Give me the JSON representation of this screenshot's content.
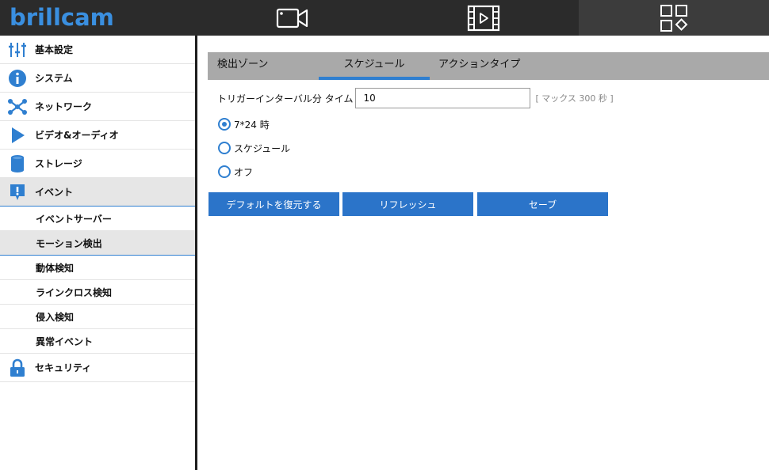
{
  "brand": {
    "name": "brillcam"
  },
  "topnav": [
    {
      "icon": "video-camera-icon"
    },
    {
      "icon": "film-playback-icon"
    },
    {
      "icon": "settings-grid-icon"
    }
  ],
  "sidebar": {
    "items": [
      {
        "label": "基本設定",
        "icon": "sliders-icon"
      },
      {
        "label": "システム",
        "icon": "info-icon"
      },
      {
        "label": "ネットワーク",
        "icon": "network-icon"
      },
      {
        "label": "ビデオ&オーディオ",
        "icon": "play-icon"
      },
      {
        "label": "ストレージ",
        "icon": "database-icon"
      },
      {
        "label": "イベント",
        "icon": "alert-icon"
      },
      {
        "label": "セキュリティ",
        "icon": "lock-icon"
      }
    ],
    "event_sub": [
      "イベントサーバー",
      "モーション検出",
      "動体検知",
      "ラインクロス検知",
      "侵入検知",
      "異常イベント"
    ]
  },
  "tabs": [
    "検出ゾーン",
    "スケジュール",
    "アクションタイプ"
  ],
  "form": {
    "interval_label": "トリガーインターバル分 タイム",
    "interval_value": "10",
    "interval_hint": "[ マックス 300 秒 ]",
    "options": [
      "7*24 時",
      "スケジュール",
      "オフ"
    ],
    "selected_option": "7*24 時"
  },
  "buttons": {
    "restore": "デフォルトを復元する",
    "refresh": "リフレッシュ",
    "save": "セーブ"
  },
  "colors": {
    "accent": "#2f7fd0",
    "topbar": "#2b2b2b",
    "button": "#2b74c9",
    "tabbar": "#a9a9a9"
  }
}
